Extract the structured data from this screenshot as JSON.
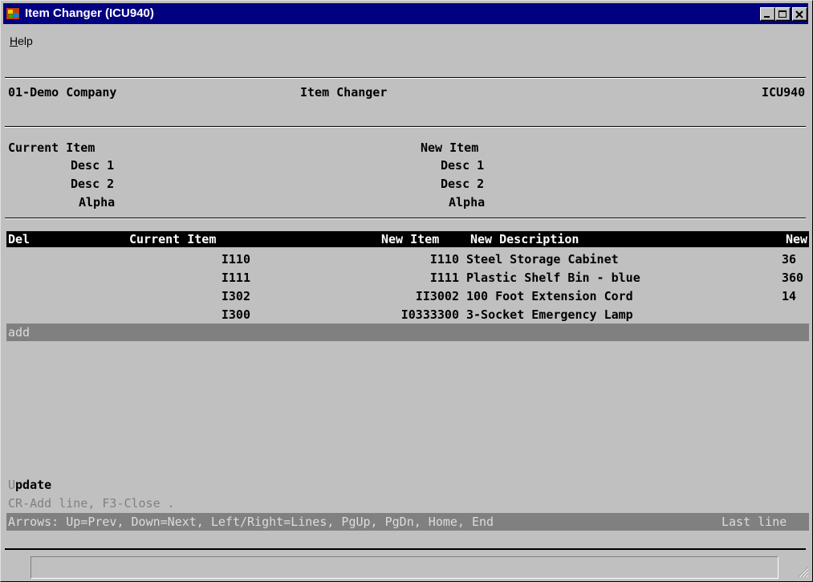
{
  "window": {
    "title": "Item Changer (ICU940)",
    "menu": [
      {
        "label": "Help",
        "accel": "H",
        "rest": "elp"
      }
    ]
  },
  "header": {
    "company": "01-Demo Company",
    "program_title": "Item Changer",
    "program_code": "ICU940"
  },
  "form": {
    "left_labels": [
      "Current Item",
      "Desc 1",
      "Desc 2",
      "Alpha"
    ],
    "right_labels": [
      "New Item",
      "Desc 1",
      "Desc 2",
      "Alpha"
    ]
  },
  "grid": {
    "columns": {
      "del": "Del",
      "current_item": "Current Item",
      "new_item": "New Item",
      "new_description": "New Description",
      "new": "New"
    },
    "rows": [
      {
        "current_item": "I110",
        "new_item": "I110",
        "new_description": "Steel Storage Cabinet",
        "new": "36"
      },
      {
        "current_item": "I111",
        "new_item": "I111",
        "new_description": "Plastic Shelf Bin - blue",
        "new": "360"
      },
      {
        "current_item": "I302",
        "new_item": "II3002",
        "new_description": "100 Foot Extension Cord",
        "new": "14"
      },
      {
        "current_item": "I300",
        "new_item": "I0333300",
        "new_description": "3-Socket Emergency Lamp",
        "new": ""
      }
    ],
    "add_label": "add"
  },
  "footer": {
    "mode_first": "U",
    "mode_rest": "pdate",
    "hint": "CR-Add line, F3-Close .",
    "keys": "Arrows: Up=Prev, Down=Next, Left/Right=Lines, PgUp, PgDn, Home, End",
    "position": "Last line"
  }
}
